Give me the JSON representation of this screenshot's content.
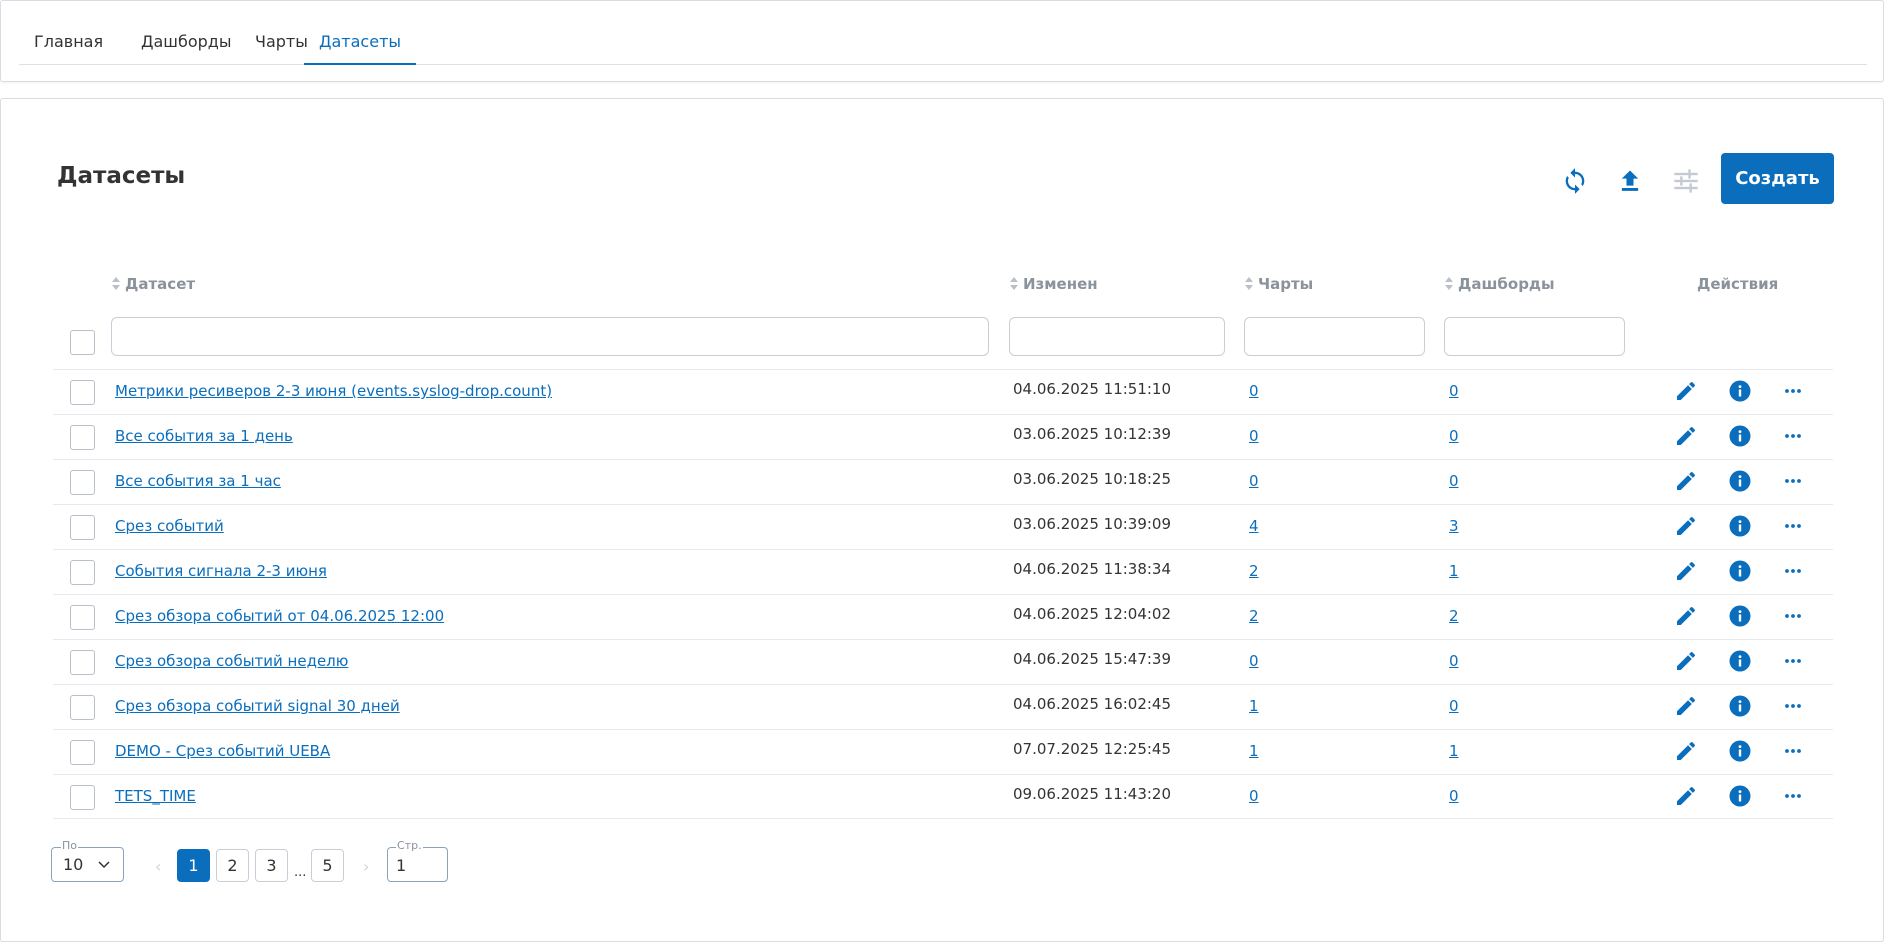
{
  "nav": {
    "tabs": [
      {
        "label": "Главная"
      },
      {
        "label": "Дашборды"
      },
      {
        "label": "Чарты"
      },
      {
        "label": "Датасеты"
      }
    ],
    "active_tab": "Датасеты"
  },
  "page": {
    "title": "Датасеты",
    "create_label": "Создать",
    "toolbar_icons": [
      "refresh-icon",
      "upload-icon",
      "filter-settings-icon"
    ]
  },
  "table": {
    "headers": {
      "dataset": "Датасет",
      "modified": "Изменен",
      "charts": "Чарты",
      "dashboards": "Дашборды",
      "actions": "Действия"
    },
    "filters": {
      "dataset": "",
      "modified": "",
      "charts": "",
      "dashboards": ""
    },
    "action_icons": [
      "edit-icon",
      "info-icon",
      "more-icon"
    ],
    "rows": [
      {
        "name": "Метрики ресиверов 2-3 июня (events.syslog-drop.count)",
        "modified": "04.06.2025 11:51:10",
        "charts": "0",
        "dashboards": "0"
      },
      {
        "name": "Все события за 1 день",
        "modified": "03.06.2025 10:12:39",
        "charts": "0",
        "dashboards": "0"
      },
      {
        "name": "Все события за 1 час",
        "modified": "03.06.2025 10:18:25",
        "charts": "0",
        "dashboards": "0"
      },
      {
        "name": "Срез событий",
        "modified": "03.06.2025 10:39:09",
        "charts": "4",
        "dashboards": "3"
      },
      {
        "name": "События сигнала 2-3 июня",
        "modified": "04.06.2025 11:38:34",
        "charts": "2",
        "dashboards": "1"
      },
      {
        "name": "Срез обзора событий от 04.06.2025 12:00",
        "modified": "04.06.2025 12:04:02",
        "charts": "2",
        "dashboards": "2"
      },
      {
        "name": "Срез обзора событий неделю",
        "modified": "04.06.2025 15:47:39",
        "charts": "0",
        "dashboards": "0"
      },
      {
        "name": "Срез обзора событий signal 30 дней",
        "modified": "04.06.2025 16:02:45",
        "charts": "1",
        "dashboards": "0"
      },
      {
        "name": "DEMO - Срез событий UEBA",
        "modified": "07.07.2025 12:25:45",
        "charts": "1",
        "dashboards": "1"
      },
      {
        "name": "TETS_TIME",
        "modified": "09.06.2025 11:43:20",
        "charts": "0",
        "dashboards": "0"
      }
    ]
  },
  "pagination": {
    "per_page_label": "По",
    "per_page": "10",
    "pages": [
      "1",
      "2",
      "3",
      "5"
    ],
    "ellipsis": "...",
    "current": "1",
    "goto_label": "Стр.",
    "goto_value": "1"
  },
  "colors": {
    "accent": "#0a6ebd",
    "muted": "#8a929c",
    "border": "#c9ced6"
  }
}
